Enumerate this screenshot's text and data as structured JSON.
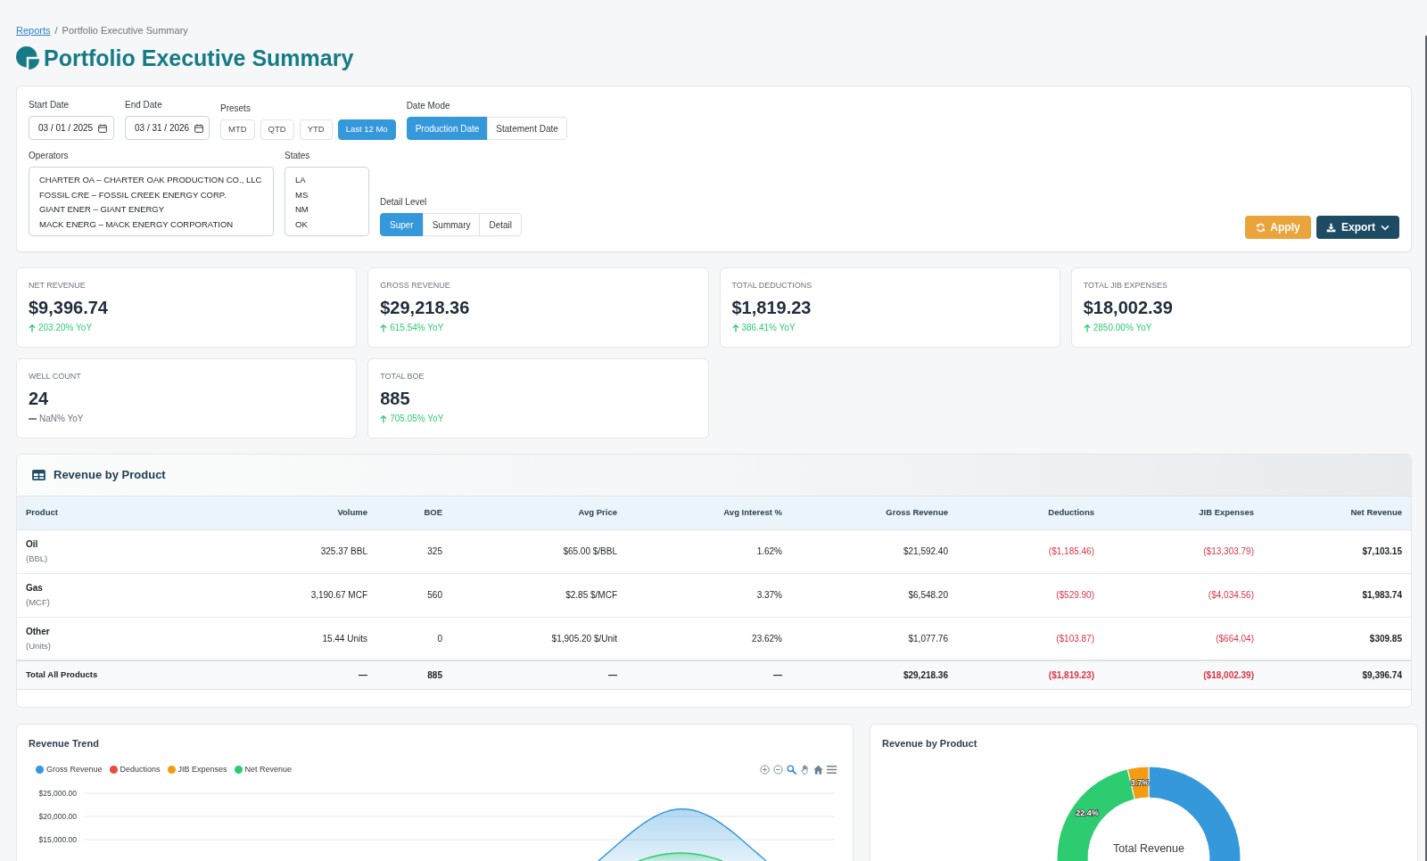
{
  "breadcrumb": {
    "link": "Reports",
    "separator": "/",
    "current": "Portfolio Executive Summary"
  },
  "page_title": "Portfolio Executive Summary",
  "filters": {
    "start_date": {
      "label": "Start Date",
      "value": "03 / 01 / 2025"
    },
    "end_date": {
      "label": "End Date",
      "value": "03 / 31 / 2026"
    },
    "presets": {
      "label": "Presets",
      "options": [
        {
          "label": "MTD",
          "selected": false
        },
        {
          "label": "QTD",
          "selected": false
        },
        {
          "label": "YTD",
          "selected": false
        },
        {
          "label": "Last 12 Mo",
          "selected": true
        }
      ]
    },
    "date_mode": {
      "label": "Date Mode",
      "options": [
        {
          "label": "Production Date",
          "selected": true
        },
        {
          "label": "Statement Date",
          "selected": false
        }
      ]
    },
    "operators": {
      "label": "Operators",
      "options": [
        "CHARTER OA – CHARTER OAK PRODUCTION CO., LLC",
        "FOSSIL CRE – FOSSIL CREEK ENERGY CORP.",
        "GIANT ENER – GIANT ENERGY",
        "MACK ENERG – MACK ENERGY CORPORATION"
      ]
    },
    "states": {
      "label": "States",
      "options": [
        "LA",
        "MS",
        "NM",
        "OK"
      ]
    },
    "detail_level": {
      "label": "Detail Level",
      "options": [
        {
          "label": "Super",
          "selected": true
        },
        {
          "label": "Summary",
          "selected": false
        },
        {
          "label": "Detail",
          "selected": false
        }
      ]
    }
  },
  "actions": {
    "apply": "Apply",
    "export": "Export"
  },
  "kpis": [
    {
      "label": "NET REVENUE",
      "value": "$9,396.74",
      "change": "203.20% YoY",
      "kind": "up"
    },
    {
      "label": "GROSS REVENUE",
      "value": "$29,218.36",
      "change": "615.54% YoY",
      "kind": "up"
    },
    {
      "label": "TOTAL DEDUCTIONS",
      "value": "$1,819.23",
      "change": "386.41% YoY",
      "kind": "up"
    },
    {
      "label": "TOTAL JIB EXPENSES",
      "value": "$18,002.39",
      "change": "2850.00% YoY",
      "kind": "up"
    },
    {
      "label": "WELL COUNT",
      "value": "24",
      "change": "NaN% YoY",
      "kind": "flat"
    },
    {
      "label": "TOTAL BOE",
      "value": "885",
      "change": "705.05% YoY",
      "kind": "up"
    }
  ],
  "revenue_table": {
    "title": "Revenue by Product",
    "columns": [
      {
        "label": "Product",
        "kind": "text"
      },
      {
        "label": "Volume",
        "kind": "number"
      },
      {
        "label": "BOE",
        "kind": "number"
      },
      {
        "label": "Avg Price",
        "kind": "number"
      },
      {
        "label": "Avg Interest %",
        "kind": "number"
      },
      {
        "label": "Gross Revenue",
        "kind": "number"
      },
      {
        "label": "Deductions",
        "kind": "negative"
      },
      {
        "label": "JIB Expenses",
        "kind": "negative"
      },
      {
        "label": "Net Revenue",
        "kind": "net"
      }
    ],
    "rows": [
      {
        "cells": [
          "Oil",
          "325.37 BBL",
          "325",
          "$65.00 $/BBL",
          "1.62%",
          "$21,592.40",
          "($1,185.46)",
          "($13,303.79)",
          "$7,103.15"
        ],
        "unit": "(BBL)"
      },
      {
        "cells": [
          "Gas",
          "3,190.67 MCF",
          "560",
          "$2.85 $/MCF",
          "3.37%",
          "$6,548.20",
          "($529.90)",
          "($4,034.56)",
          "$1,983.74"
        ],
        "unit": "(MCF)"
      },
      {
        "cells": [
          "Other",
          "15.44 Units",
          "0",
          "$1,905.20 $/Unit",
          "23.62%",
          "$1,077.76",
          "($103.87)",
          "($664.04)",
          "$309.85"
        ],
        "unit": "(Units)"
      }
    ],
    "total": {
      "cells": [
        "Total All Products",
        "—",
        "885",
        "—",
        "—",
        "$29,218.36",
        "($1,819.23)",
        "($18,002.39)",
        "$9,396.74"
      ]
    }
  },
  "revenue_trend": {
    "title": "Revenue Trend",
    "legend": [
      {
        "label": "Gross Revenue",
        "color": "#3498db"
      },
      {
        "label": "Deductions",
        "color": "#e74c3c"
      },
      {
        "label": "JIB Expenses",
        "color": "#f39c12"
      },
      {
        "label": "Net Revenue",
        "color": "#2ecc71"
      }
    ],
    "toolbar": [
      {
        "kind": "zoom_in",
        "selected": false
      },
      {
        "kind": "zoom_out",
        "selected": false
      },
      {
        "kind": "zoom",
        "selected": true
      },
      {
        "kind": "pan",
        "selected": false
      },
      {
        "kind": "home",
        "selected": false
      },
      {
        "kind": "menu",
        "selected": false
      }
    ],
    "y_axis_labels": [
      "$25,000.00",
      "$20,000.00",
      "$15,000.00"
    ]
  },
  "product_chart": {
    "center_label": "Total Revenue",
    "chart_data": {
      "type": "donut",
      "title": "Revenue by Product",
      "values": [
        73.9,
        22.4,
        3.7
      ],
      "colors": [
        "#3498db",
        "#2ecc71",
        "#f39c12"
      ],
      "value_labels": [
        null,
        "22.4%",
        "3.7%"
      ]
    }
  }
}
